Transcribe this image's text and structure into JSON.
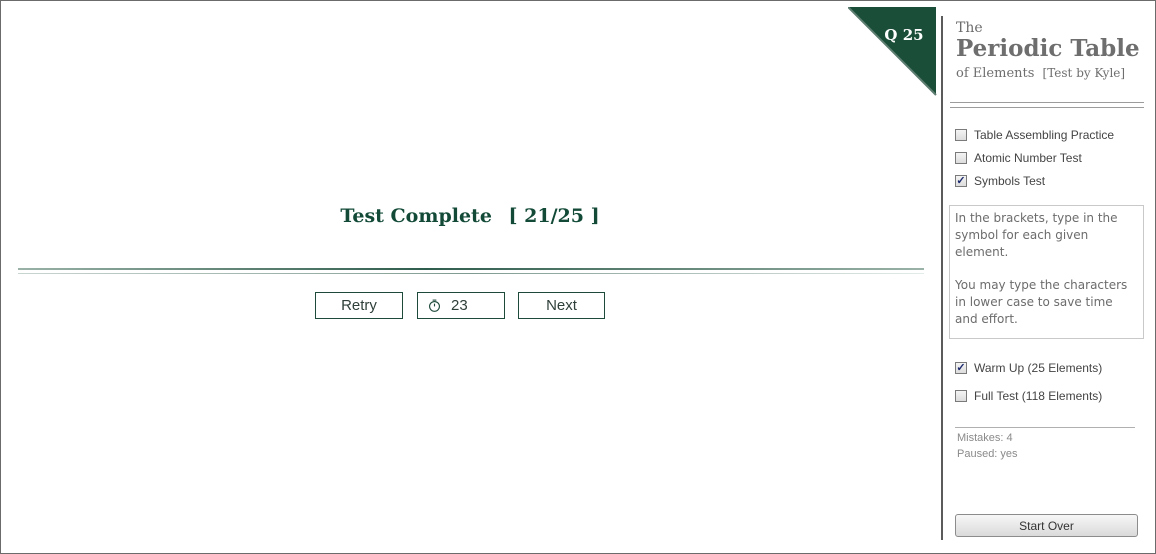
{
  "app": {
    "title_the": "The",
    "title_main": "Periodic Table",
    "title_sub": "of Elements",
    "author": "[Test by Kyle]"
  },
  "question_banner": {
    "label": "Q 25",
    "color": "#1a4e38"
  },
  "result": {
    "label": "Test Complete",
    "score": "[ 21/25 ]"
  },
  "buttons": {
    "retry": "Retry",
    "timer_value": "23",
    "timer_icon": "stopwatch-icon",
    "next": "Next",
    "start_over": "Start Over"
  },
  "test_modes": [
    {
      "label": "Table Assembling Practice",
      "checked": false
    },
    {
      "label": "Atomic Number Test",
      "checked": false
    },
    {
      "label": "Symbols Test",
      "checked": true
    }
  ],
  "instructions": {
    "paragraph1": "In the brackets, type in the symbol for each given element.",
    "paragraph2": "You may type the characters in lower case to save time and effort."
  },
  "test_length": [
    {
      "label": "Warm Up (25 Elements)",
      "checked": true
    },
    {
      "label": "Full Test (118 Elements)",
      "checked": false
    }
  ],
  "status": {
    "mistakes": "Mistakes: 4",
    "paused": "Paused: yes"
  },
  "colors": {
    "accent": "#124a37",
    "banner": "#1a4e38"
  }
}
